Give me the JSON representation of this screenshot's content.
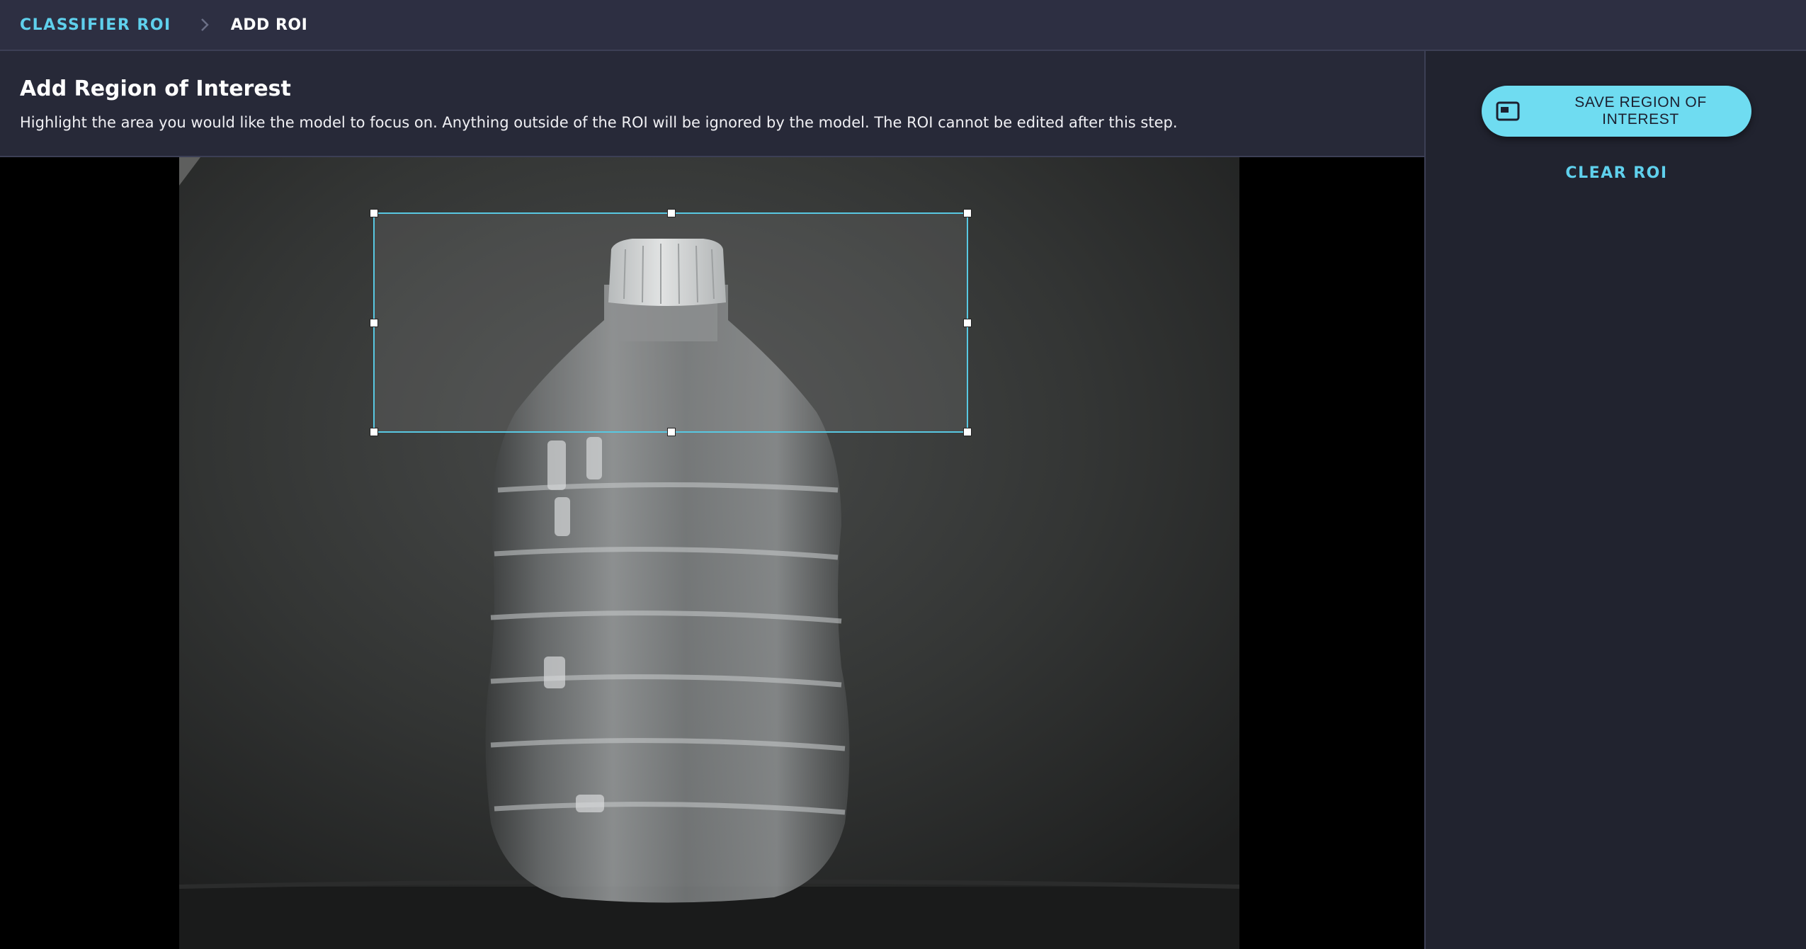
{
  "breadcrumb": {
    "parent_label": "CLASSIFIER ROI",
    "separator_icon": "chevron-right-icon",
    "current_label": "ADD ROI"
  },
  "header": {
    "title": "Add Region of Interest",
    "description": "Highlight the area you would like the model to focus on. Anything outside of the ROI will be ignored by the model. The ROI cannot be edited after this step."
  },
  "actions": {
    "save_label": "SAVE REGION OF INTEREST",
    "save_icon": "picture-in-picture-icon",
    "clear_label": "CLEAR ROI"
  },
  "colors": {
    "accent": "#5fd0ec",
    "button_bg": "#6fdcf1",
    "topbar_bg": "#2d2f42",
    "panel_bg": "#21232f",
    "roi_border": "#58c8e2"
  }
}
